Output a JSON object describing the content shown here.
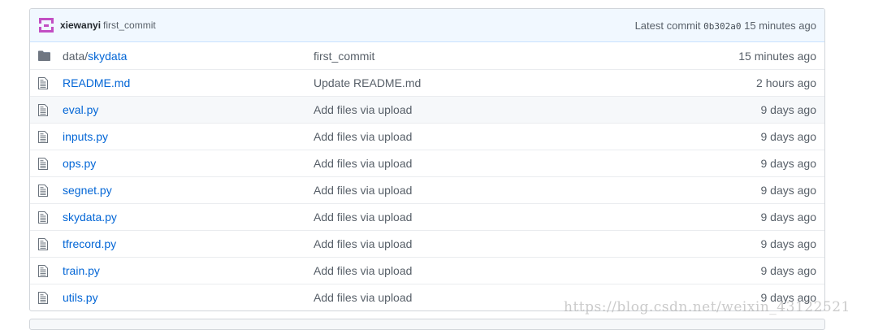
{
  "commit": {
    "author": "xiewanyi",
    "message": "first_commit",
    "latest_label": "Latest commit",
    "sha": "0b302a0",
    "age": "15 minutes ago"
  },
  "files": [
    {
      "type": "folder",
      "name_prefix": "data/",
      "name": "skydata",
      "message": "first_commit",
      "age": "15 minutes ago"
    },
    {
      "type": "file",
      "name_prefix": "",
      "name": "README.md",
      "message": "Update README.md",
      "age": "2 hours ago"
    },
    {
      "type": "file",
      "name_prefix": "",
      "name": "eval.py",
      "message": "Add files via upload",
      "age": "9 days ago"
    },
    {
      "type": "file",
      "name_prefix": "",
      "name": "inputs.py",
      "message": "Add files via upload",
      "age": "9 days ago"
    },
    {
      "type": "file",
      "name_prefix": "",
      "name": "ops.py",
      "message": "Add files via upload",
      "age": "9 days ago"
    },
    {
      "type": "file",
      "name_prefix": "",
      "name": "segnet.py",
      "message": "Add files via upload",
      "age": "9 days ago"
    },
    {
      "type": "file",
      "name_prefix": "",
      "name": "skydata.py",
      "message": "Add files via upload",
      "age": "9 days ago"
    },
    {
      "type": "file",
      "name_prefix": "",
      "name": "tfrecord.py",
      "message": "Add files via upload",
      "age": "9 days ago"
    },
    {
      "type": "file",
      "name_prefix": "",
      "name": "train.py",
      "message": "Add files via upload",
      "age": "9 days ago"
    },
    {
      "type": "file",
      "name_prefix": "",
      "name": "utils.py",
      "message": "Add files via upload",
      "age": "9 days ago"
    }
  ],
  "watermark": "https://blog.csdn.net/weixin_43122521",
  "colors": {
    "link": "#0366d6",
    "muted": "#586069",
    "commit_bg": "#f1f8ff",
    "avatar": "#c24ec3",
    "folder_icon": "#79b8ff"
  }
}
